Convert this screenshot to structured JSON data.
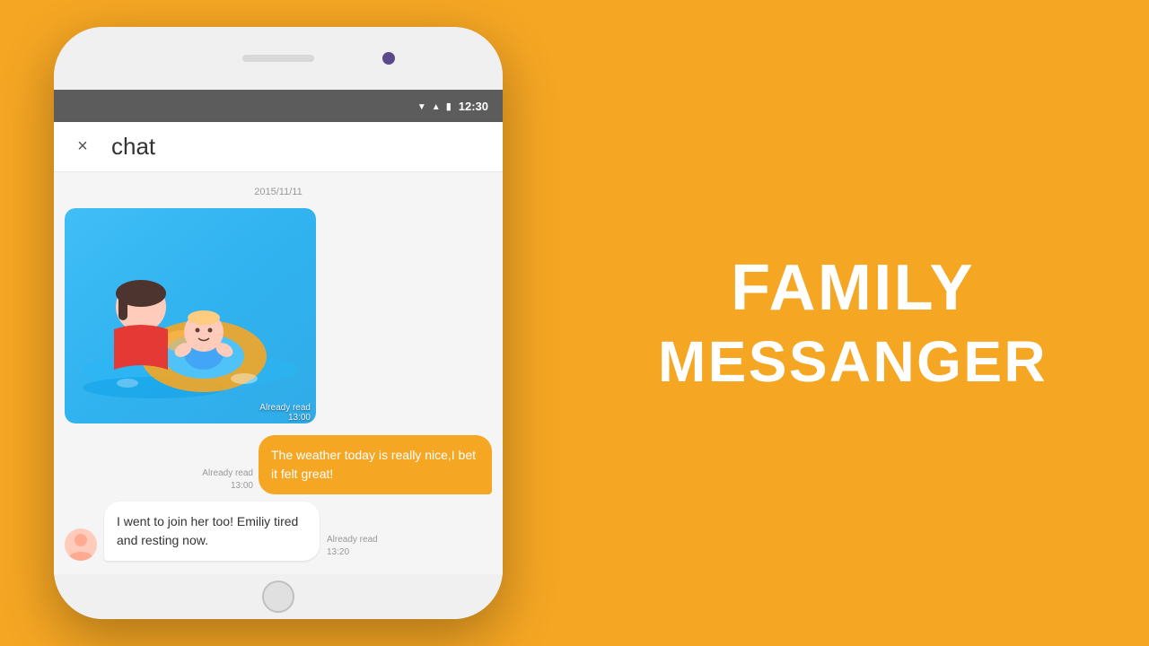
{
  "background_color": "#F5A623",
  "phone": {
    "status_bar": {
      "time": "12:30",
      "icons": [
        "wifi",
        "signal",
        "battery"
      ]
    },
    "header": {
      "close_label": "×",
      "title": "chat"
    },
    "chat": {
      "date_label": "2015/11/11",
      "image_message": {
        "read_label": "Already read",
        "time": "13:00"
      },
      "outgoing_message": {
        "text": "The weather today is really nice,I bet it felt great!",
        "read_label": "Already read",
        "time": "13:00"
      },
      "incoming_message": {
        "text": "I went to join her too! Emiliy tired and resting now.",
        "read_label": "Already read",
        "time": "13:20"
      }
    }
  },
  "brand": {
    "line1": "FAMILY",
    "line2": "MESSANGER"
  }
}
